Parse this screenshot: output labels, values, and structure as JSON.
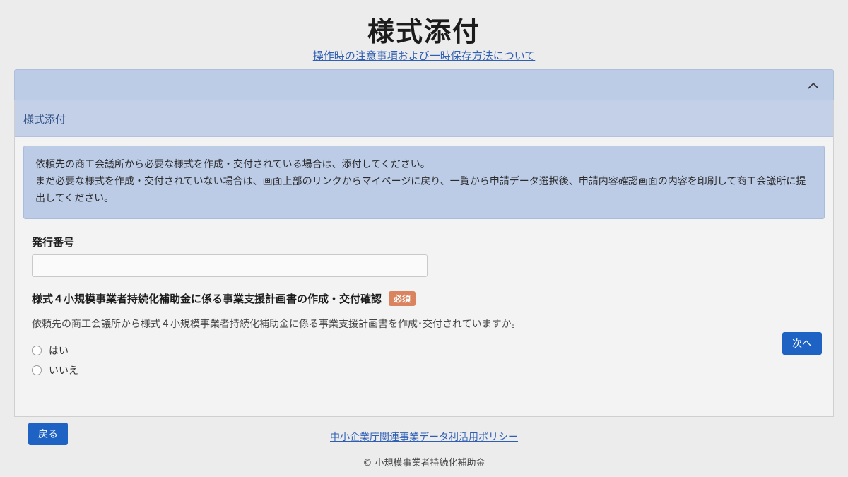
{
  "page": {
    "title": "様式添付",
    "notice_link": "操作時の注意事項および一時保存方法について"
  },
  "section": {
    "header": "様式添付",
    "info_lines": [
      "依頼先の商工会議所から必要な様式を作成・交付されている場合は、添付してください。",
      "まだ必要な様式を作成・交付されていない場合は、画面上部のリンクからマイページに戻り、一覧から申請データ選択後、申請内容確認画面の内容を印刷して商工会議所に提出してください。"
    ]
  },
  "form": {
    "issue_number_label": "発行番号",
    "issue_number_value": "",
    "question_title": "様式４小規模事業者持続化補助金に係る事業支援計画書の作成・交付確認",
    "required_badge": "必須",
    "question_desc": "依頼先の商工会議所から様式４小規模事業者持続化補助金に係る事業支援計画書を作成･交付されていますか。",
    "options": [
      "はい",
      "いいえ"
    ],
    "next_button": "次へ"
  },
  "nav": {
    "back_button": "戻る"
  },
  "footer": {
    "policy_link": "中小企業庁関連事業データ利活用ポリシー",
    "copyright": "© 小規模事業者持続化補助金"
  },
  "colors": {
    "accent": "#1e63c4",
    "info_bg": "#bccbe6",
    "required_badge": "#d9835f",
    "link": "#2f5fb5"
  },
  "icons": {
    "accordion_toggle": "chevron-up-icon"
  }
}
